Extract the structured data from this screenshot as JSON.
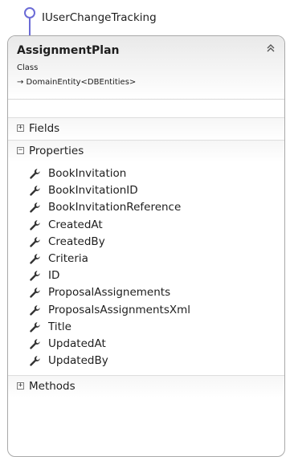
{
  "interface": {
    "name": "IUserChangeTracking"
  },
  "class": {
    "name": "AssignmentPlan",
    "stereotype": "Class",
    "inherits": "→ DomainEntity<DBEntities>",
    "collapse_glyph": "≈"
  },
  "sections": {
    "fields": {
      "label": "Fields",
      "toggle": "+"
    },
    "properties": {
      "label": "Properties",
      "toggle": "−",
      "items": [
        "BookInvitation",
        "BookInvitationID",
        "BookInvitationReference",
        "CreatedAt",
        "CreatedBy",
        "Criteria",
        "ID",
        "ProposalAssignements",
        "ProposalsAssignmentsXml",
        "Title",
        "UpdatedAt",
        "UpdatedBy"
      ]
    },
    "methods": {
      "label": "Methods",
      "toggle": "+"
    }
  },
  "colors": {
    "interface_accent": "#6b6bd6",
    "icon": "#333333"
  },
  "icons": {
    "property": "wrench-icon",
    "interface": "lollipop-icon"
  }
}
